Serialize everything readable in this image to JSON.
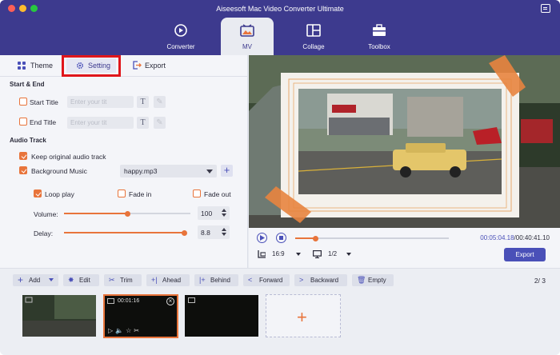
{
  "window": {
    "title": "Aiseesoft Mac Video Converter Ultimate"
  },
  "top_tabs": [
    {
      "label": "Converter",
      "icon": "converter-icon"
    },
    {
      "label": "MV",
      "icon": "mv-icon"
    },
    {
      "label": "Collage",
      "icon": "collage-icon"
    },
    {
      "label": "Toolbox",
      "icon": "toolbox-icon"
    }
  ],
  "sub_tabs": {
    "theme": "Theme",
    "setting": "Setting",
    "export": "Export"
  },
  "start_end": {
    "heading": "Start & End",
    "start_title_label": "Start Title",
    "start_title_placeholder": "Enter your tit",
    "end_title_label": "End Title",
    "end_title_placeholder": "Enter your tit",
    "font_button": "T"
  },
  "audio": {
    "heading": "Audio Track",
    "keep_original": "Keep original audio track",
    "background_music": "Background Music",
    "music_file": "happy.mp3",
    "loop_play": "Loop play",
    "fade_in": "Fade in",
    "fade_out": "Fade out",
    "volume_label": "Volume:",
    "volume_value": "100",
    "volume_level": 0.5,
    "delay_label": "Delay:",
    "delay_value": "8.8",
    "delay_level": 0.99
  },
  "player": {
    "time_current": "00:05:04.18",
    "time_total": "/00:40:41.10",
    "progress": 0.13,
    "aspect": "16:9",
    "screen": "1/2",
    "export_label": "Export"
  },
  "toolbar": {
    "add": "Add",
    "edit": "Edit",
    "trim": "Trim",
    "ahead": "Ahead",
    "behind": "Behind",
    "forward": "Forward",
    "backward": "Backward",
    "empty": "Empty",
    "page": "2/ 3"
  },
  "clips": [
    {
      "selected": false
    },
    {
      "selected": true,
      "duration": "00:01:16"
    },
    {
      "selected": false
    }
  ],
  "colors": {
    "header": "#3d3a8e",
    "accent": "#e8743b",
    "primary": "#4a50b8",
    "highlight": "#e0161b"
  }
}
